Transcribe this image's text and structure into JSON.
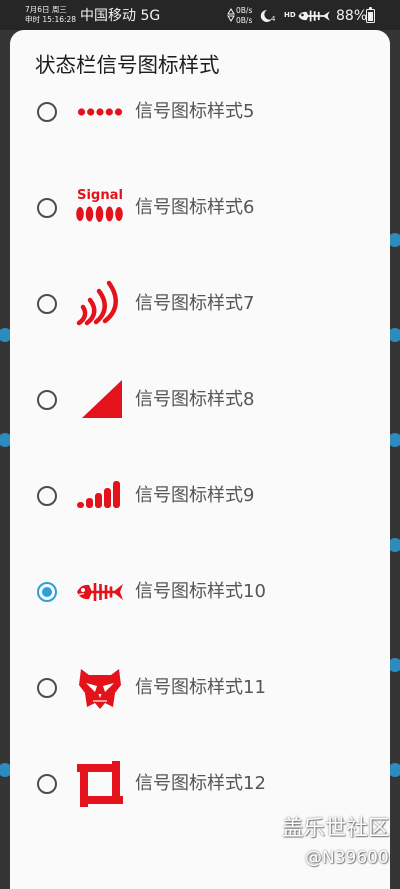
{
  "status_bar": {
    "date": "7月6日 周三",
    "time": "申时 15:16:28",
    "carrier": "中国移动 5G",
    "upload_speed": "0B/s",
    "download_speed": "0B/s",
    "moon_badge": "4",
    "hd_label": "HD",
    "battery_percent": "88%",
    "battery_level": 0.88,
    "icons": [
      "network-speed-arrows-icon",
      "moon-icon",
      "fishbone-signal-icon",
      "battery-icon"
    ]
  },
  "dialog": {
    "title": "状态栏信号图标样式",
    "options": [
      {
        "label": "信号图标样式5",
        "icon": "five-dots-signal-icon",
        "selected": false
      },
      {
        "label": "信号图标样式6",
        "icon": "signal-text-ovals-icon",
        "icon_text": "Signal",
        "selected": false
      },
      {
        "label": "信号图标样式7",
        "icon": "curved-strokes-signal-icon",
        "selected": false
      },
      {
        "label": "信号图标样式8",
        "icon": "triangle-signal-icon",
        "selected": false
      },
      {
        "label": "信号图标样式9",
        "icon": "rounded-bars-signal-icon",
        "selected": false
      },
      {
        "label": "信号图标样式10",
        "icon": "fishbone-signal-icon",
        "selected": true
      },
      {
        "label": "信号图标样式11",
        "icon": "mask-signal-icon",
        "selected": false
      },
      {
        "label": "信号图标样式12",
        "icon": "pinwheel-frame-signal-icon",
        "selected": false
      }
    ]
  },
  "watermark": {
    "title": "盖乐世社区",
    "user": "@N39600"
  },
  "colors": {
    "accent": "#2aa1dc",
    "icon_red": "#e3121b",
    "dialog_background": "#fafafa",
    "backdrop": "#353535"
  }
}
